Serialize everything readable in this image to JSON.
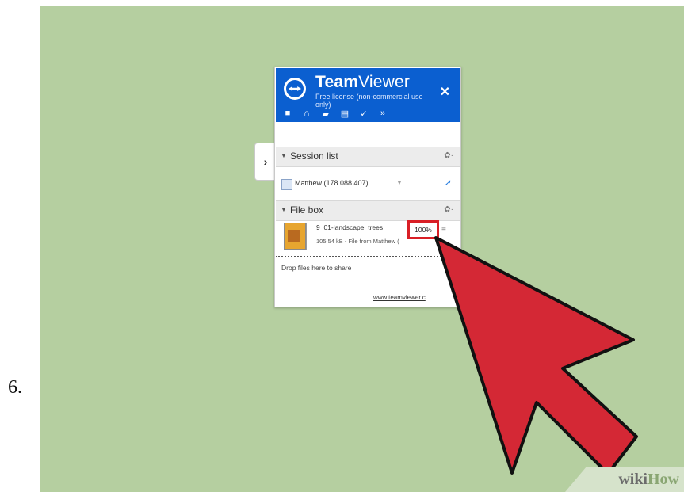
{
  "step_number": "6.",
  "teamviewer": {
    "title_bold": "Team",
    "title_regular": "Viewer",
    "license": "Free license (non-commercial use only)",
    "close_symbol": "✕",
    "toolbar": [
      {
        "icon": "video-icon",
        "glyph": "■"
      },
      {
        "icon": "headset-icon",
        "glyph": "∩"
      },
      {
        "icon": "chat-icon",
        "glyph": "▰"
      },
      {
        "icon": "clipboard-icon",
        "glyph": "▤"
      },
      {
        "icon": "brush-icon",
        "glyph": "✓"
      },
      {
        "icon": "more-icon",
        "glyph": "»"
      }
    ],
    "expand_glyph": "›"
  },
  "session_list": {
    "title": "Session list",
    "arrow": "▼",
    "gear": "✿·",
    "user": "Matthew (178 088 407)",
    "user_caret": "▼",
    "cursor_glyph": "➚"
  },
  "file_box": {
    "title": "File box",
    "arrow": "▼",
    "gear": "✿·",
    "file_name": "9_01-landscape_trees_",
    "percent": "100%",
    "meta": "105.54 kB - File from Matthew (",
    "menu_glyph": "≡",
    "drop_hint": "Drop files here to share",
    "footer_link": "www.teamviewer.c"
  },
  "watermark": {
    "wiki": "wiki",
    "how": "How"
  },
  "colors": {
    "header_blue": "#0b5fd0",
    "highlight_red": "#d91f26",
    "arrow_red": "#d42835",
    "background_green": "#b5cfa0"
  }
}
